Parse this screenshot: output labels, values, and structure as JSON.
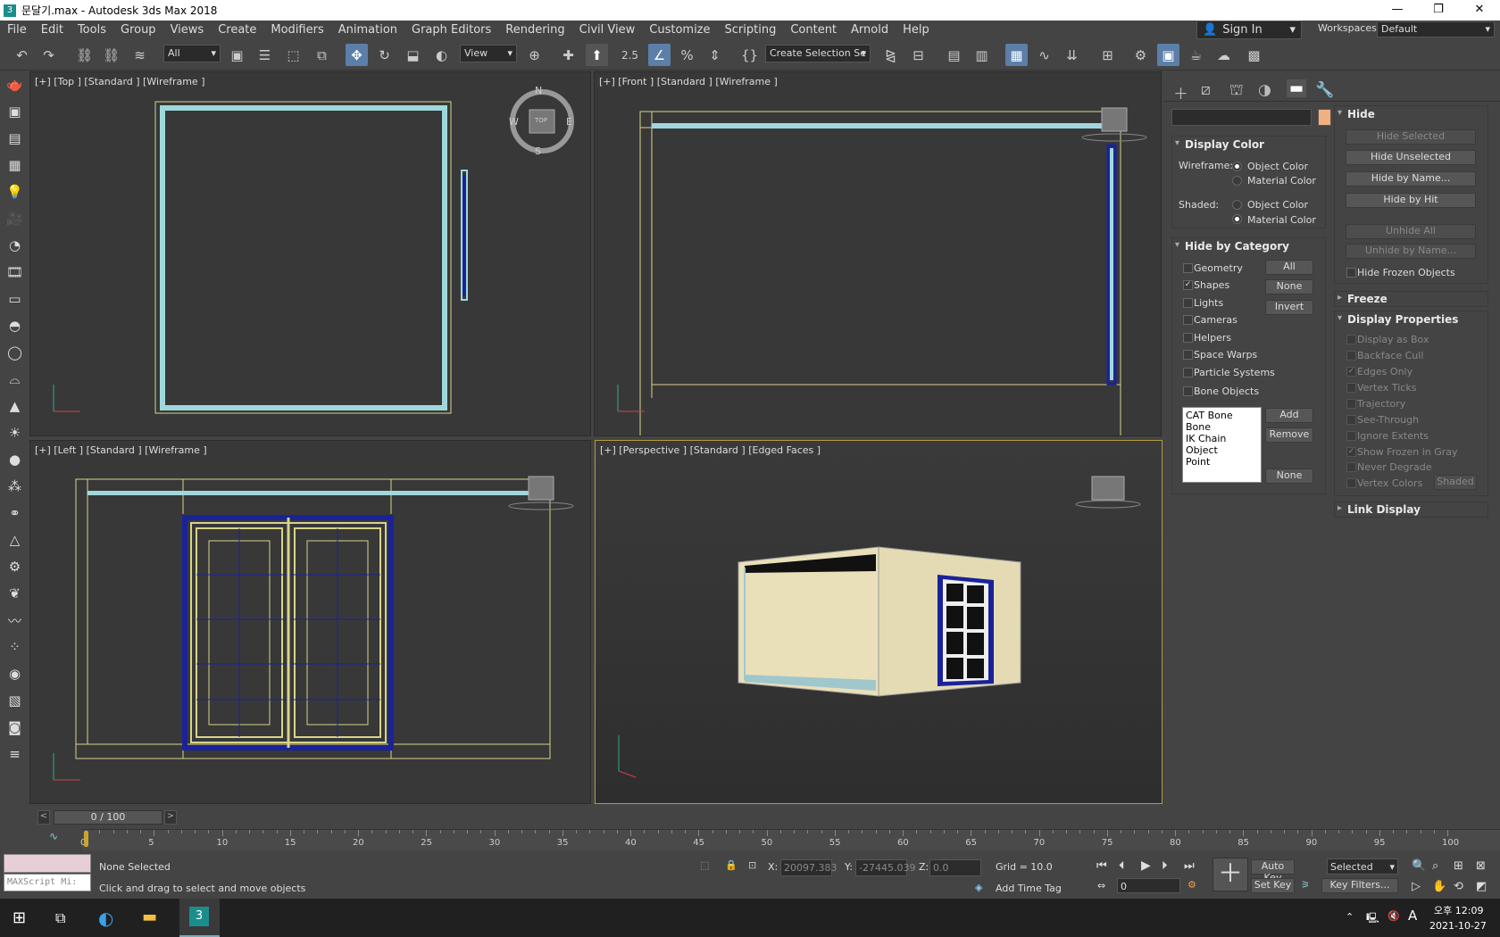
{
  "window": {
    "title": "문달기.max - Autodesk 3ds Max 2018",
    "min": "—",
    "max": "❐",
    "close": "✕"
  },
  "menu": [
    "File",
    "Edit",
    "Tools",
    "Group",
    "Views",
    "Create",
    "Modifiers",
    "Animation",
    "Graph Editors",
    "Rendering",
    "Civil View",
    "Customize",
    "Scripting",
    "Content",
    "Arnold",
    "Help"
  ],
  "signin": "Sign In",
  "workspaces": {
    "label": "Workspaces:",
    "value": "Default"
  },
  "toolbar": {
    "filter": "All",
    "refcoord": "View",
    "selset": "Create Selection Se",
    "snap": "2.5",
    "pct": "%"
  },
  "viewports": {
    "top": "[+] [Top ] [Standard ] [Wireframe ]",
    "front": "[+] [Front ] [Standard ] [Wireframe ]",
    "left": "[+] [Left ] [Standard ] [Wireframe ]",
    "persp": "[+] [Perspective ] [Standard ] [Edged Faces ]",
    "compass": {
      "n": "N",
      "s": "S",
      "e": "E",
      "w": "W",
      "cube": "TOP"
    }
  },
  "cmd": {
    "display_color": {
      "title": "Display Color",
      "wire_label": "Wireframe:",
      "shaded_label": "Shaded:",
      "obj": "Object Color",
      "mat": "Material Color"
    },
    "hide_cat": {
      "title": "Hide by Category",
      "items": [
        "Geometry",
        "Shapes",
        "Lights",
        "Cameras",
        "Helpers",
        "Space Warps",
        "Particle Systems",
        "Bone Objects"
      ],
      "all": "All",
      "none": "None",
      "invert": "Invert",
      "list": [
        "CAT Bone",
        "Bone",
        "IK Chain Object",
        "Point"
      ],
      "add": "Add",
      "remove": "Remove",
      "none2": "None"
    },
    "hide": {
      "title": "Hide",
      "btns": [
        "Hide Selected",
        "Hide Unselected",
        "Hide by Name...",
        "Hide by Hit",
        "Unhide All",
        "Unhide by Name..."
      ],
      "frozen": "Hide Frozen Objects"
    },
    "freeze": "Freeze",
    "dispprops": {
      "title": "Display Properties",
      "items": [
        "Display as Box",
        "Backface Cull",
        "Edges Only",
        "Vertex Ticks",
        "Trajectory",
        "See-Through",
        "Ignore Extents",
        "Show Frozen in Gray",
        "Never Degrade",
        "Vertex Colors"
      ],
      "shaded": "Shaded"
    },
    "link": "Link Display"
  },
  "timeline": {
    "frame": "0 / 100",
    "ticks": [
      "0",
      "5",
      "10",
      "15",
      "20",
      "25",
      "30",
      "35",
      "40",
      "45",
      "50",
      "55",
      "60",
      "65",
      "70",
      "75",
      "80",
      "85",
      "90",
      "95",
      "100"
    ]
  },
  "status": {
    "maxscript": "MAXScript Mi:",
    "selected": "None Selected",
    "hint": "Click and drag to select and move objects",
    "x_label": "X:",
    "x": "20097.383",
    "y_label": "Y:",
    "y": "-27445.039",
    "z_label": "Z:",
    "z": "0.0",
    "grid": "Grid = 10.0",
    "addtag": "Add Time Tag",
    "autokey": "Auto Key",
    "setkey": "Set Key",
    "keysel": "Selected",
    "keyfilters": "Key Filters...",
    "frame": "0"
  },
  "taskbar": {
    "time": "오후 12:09",
    "date": "2021-10-27",
    "ime": "A"
  }
}
